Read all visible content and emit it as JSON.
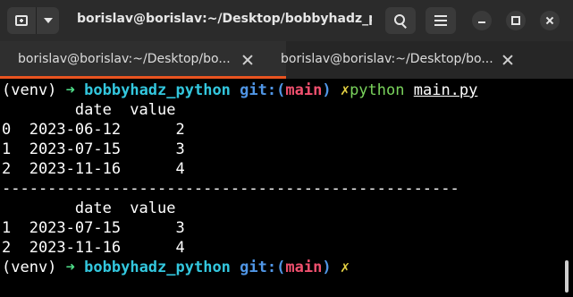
{
  "titlebar": {
    "title": "borislav@borislav:~/Desktop/bobbyhadz_py..."
  },
  "tabs": [
    {
      "label": "borislav@borislav:~/Desktop/bo...",
      "active": true
    },
    {
      "label": "borislav@borislav:~/Desktop/bo...",
      "active": false
    }
  ],
  "icons": {
    "new_tab": "new-tab-icon",
    "dropdown": "chevron-down-icon",
    "search": "search-icon",
    "menu": "hamburger-menu-icon",
    "minimize": "minimize-icon",
    "maximize": "maximize-icon",
    "close": "close-icon"
  },
  "colors": {
    "accent": "#e95420",
    "prompt_arrow": "#4fe08a",
    "directory": "#33c7de",
    "git_label": "#5096e6",
    "branch": "#f0506e",
    "dirty_mark": "#e5d243",
    "command": "#7ad35c"
  },
  "terminal": {
    "prompt1": {
      "venv": "(venv) ",
      "arrow": "➜",
      "dir": "bobbyhadz_python",
      "git_open": "git:(",
      "branch": "main",
      "git_close": ")",
      "dirty": "✗",
      "command": "python",
      "file": "main.py"
    },
    "df1": {
      "header": "        date  value",
      "rows": [
        "0  2023-06-12      2",
        "1  2023-07-15      3",
        "2  2023-11-16      4"
      ]
    },
    "separator": "--------------------------------------------------",
    "df2": {
      "header": "        date  value",
      "rows": [
        "1  2023-07-15      3",
        "2  2023-11-16      4"
      ]
    },
    "prompt2": {
      "venv": "(venv) ",
      "arrow": "➜",
      "dir": "bobbyhadz_python",
      "git_open": "git:(",
      "branch": "main",
      "git_close": ")",
      "dirty": "✗"
    }
  }
}
